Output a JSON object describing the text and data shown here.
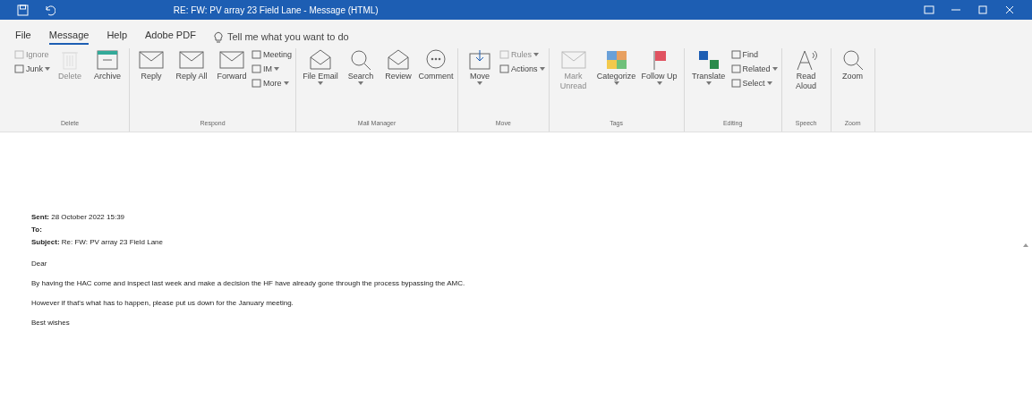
{
  "window": {
    "title": "RE: FW: PV array 23 Field Lane  -  Message (HTML)"
  },
  "tabs": [
    {
      "label": "File",
      "selected": false
    },
    {
      "label": "Message",
      "selected": true
    },
    {
      "label": "Help",
      "selected": false
    },
    {
      "label": "Adobe PDF",
      "selected": false
    }
  ],
  "tell_me": {
    "placeholder": "Tell me what you want to do"
  },
  "ribbon": [
    {
      "label": "Delete",
      "columns": [
        {
          "kind": "stack",
          "items": [
            {
              "label": "Ignore",
              "disabled": true,
              "dropdown": false
            },
            {
              "label": "Junk",
              "disabled": false,
              "dropdown": true
            }
          ]
        },
        {
          "kind": "large",
          "label": "Delete",
          "disabled": true,
          "dropdown": false
        },
        {
          "kind": "large",
          "label": "Archive",
          "disabled": false,
          "dropdown": false
        }
      ]
    },
    {
      "label": "Respond",
      "columns": [
        {
          "kind": "large",
          "label": "Reply",
          "disabled": false,
          "dropdown": false
        },
        {
          "kind": "large",
          "label": "Reply All",
          "disabled": false,
          "dropdown": false
        },
        {
          "kind": "large",
          "label": "Forward",
          "disabled": false,
          "dropdown": false
        },
        {
          "kind": "stack",
          "items": [
            {
              "label": "Meeting",
              "disabled": false,
              "dropdown": false
            },
            {
              "label": "IM",
              "disabled": false,
              "dropdown": true
            },
            {
              "label": "More",
              "disabled": false,
              "dropdown": true
            }
          ]
        }
      ]
    },
    {
      "label": "Mail Manager",
      "columns": [
        {
          "kind": "large",
          "label": "File Email",
          "disabled": false,
          "dropdown": true
        },
        {
          "kind": "large",
          "label": "Search",
          "disabled": false,
          "dropdown": true
        },
        {
          "kind": "large",
          "label": "Review",
          "disabled": false,
          "dropdown": false
        },
        {
          "kind": "large",
          "label": "Comment",
          "disabled": false,
          "dropdown": false
        }
      ]
    },
    {
      "label": "Move",
      "columns": [
        {
          "kind": "large",
          "label": "Move",
          "disabled": false,
          "dropdown": true
        },
        {
          "kind": "stack",
          "items": [
            {
              "label": "Rules",
              "disabled": true,
              "dropdown": true
            },
            {
              "label": "Actions",
              "disabled": false,
              "dropdown": true
            }
          ]
        }
      ]
    },
    {
      "label": "Tags",
      "columns": [
        {
          "kind": "large",
          "label": "Mark Unread",
          "disabled": true,
          "dropdown": false
        },
        {
          "kind": "large",
          "label": "Categorize",
          "disabled": false,
          "dropdown": true
        },
        {
          "kind": "large",
          "label": "Follow Up",
          "disabled": false,
          "dropdown": true
        }
      ]
    },
    {
      "label": "Editing",
      "columns": [
        {
          "kind": "large",
          "label": "Translate",
          "disabled": false,
          "dropdown": true
        },
        {
          "kind": "stack",
          "items": [
            {
              "label": "Find",
              "disabled": false,
              "dropdown": false
            },
            {
              "label": "Related",
              "disabled": false,
              "dropdown": true
            },
            {
              "label": "Select",
              "disabled": false,
              "dropdown": true
            }
          ]
        }
      ]
    },
    {
      "label": "Speech",
      "columns": [
        {
          "kind": "large",
          "label": "Read Aloud",
          "disabled": false,
          "dropdown": false
        }
      ]
    },
    {
      "label": "Zoom",
      "columns": [
        {
          "kind": "large",
          "label": "Zoom",
          "disabled": false,
          "dropdown": false
        }
      ]
    }
  ],
  "header": [
    {
      "label": "Sent:",
      "value": "28 October 2022 15:39"
    },
    {
      "label": "To:"
    },
    {
      "label": "Subject:",
      "value": "Re: FW: PV array 23 Field Lane"
    }
  ],
  "body": [
    "Dear",
    "By having the HAC come and inspect last week and make a decision the HF have already gone through the process bypassing the AMC.",
    "However if that's what has to happen, please put us down for the January meeting.",
    "Best wishes"
  ]
}
